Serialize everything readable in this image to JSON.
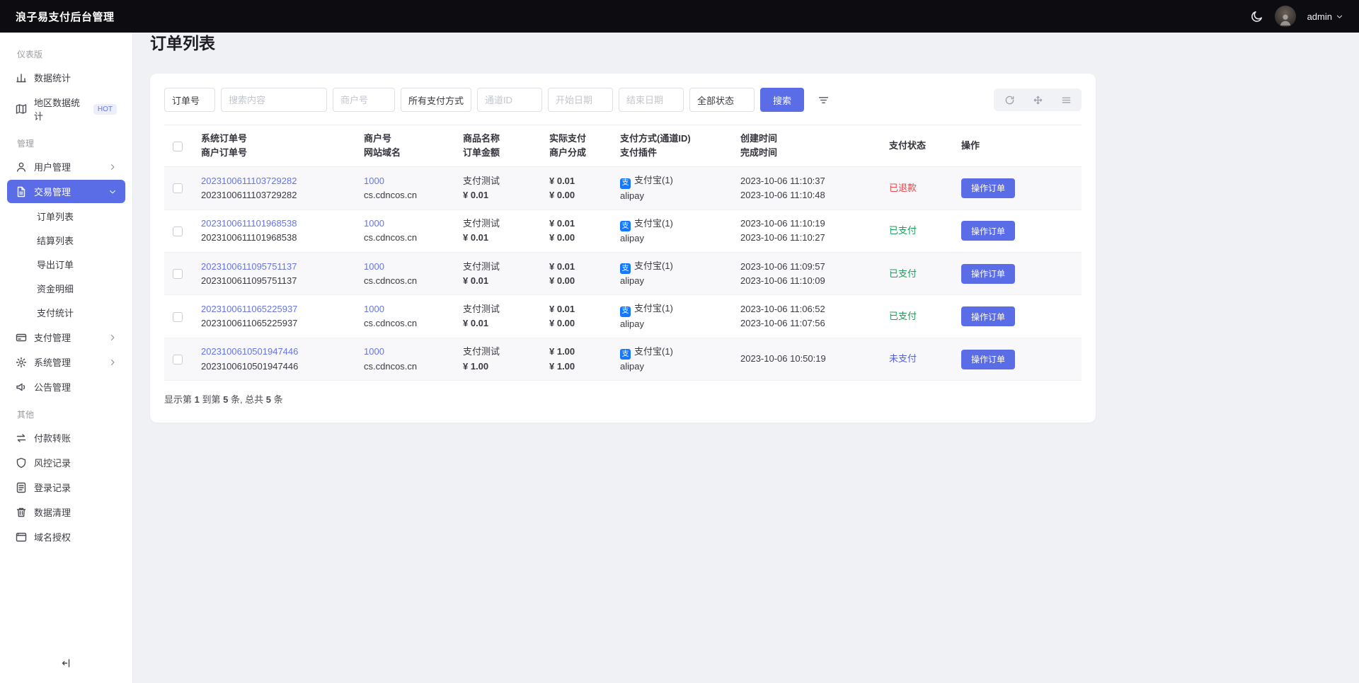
{
  "topbar": {
    "title": "浪子易支付后台管理",
    "username": "admin",
    "theme_icon": "moon-icon",
    "user_caret_icon": "chevron-down-icon"
  },
  "sidebar": {
    "sections": [
      {
        "label": "仪表版",
        "items": [
          {
            "label": "数据统计",
            "icon": "bar-chart-icon"
          },
          {
            "label": "地区数据统计",
            "icon": "map-icon",
            "badge": "HOT"
          }
        ]
      },
      {
        "label": "管理",
        "items": [
          {
            "label": "用户管理",
            "icon": "user-icon",
            "chevron": "right"
          },
          {
            "label": "交易管理",
            "icon": "document-icon",
            "chevron": "down",
            "active": true,
            "children": [
              {
                "label": "订单列表",
                "active": true
              },
              {
                "label": "结算列表"
              },
              {
                "label": "导出订单"
              },
              {
                "label": "资金明细"
              },
              {
                "label": "支付统计"
              }
            ]
          },
          {
            "label": "支付管理",
            "icon": "card-icon",
            "chevron": "right"
          },
          {
            "label": "系统管理",
            "icon": "gear-icon",
            "chevron": "right"
          },
          {
            "label": "公告管理",
            "icon": "megaphone-icon"
          }
        ]
      },
      {
        "label": "其他",
        "items": [
          {
            "label": "付款转账",
            "icon": "transfer-icon"
          },
          {
            "label": "风控记录",
            "icon": "shield-icon"
          },
          {
            "label": "登录记录",
            "icon": "log-icon"
          },
          {
            "label": "数据清理",
            "icon": "trash-icon"
          },
          {
            "label": "域名授权",
            "icon": "domain-icon"
          }
        ]
      }
    ],
    "collapse_icon": "collapse-left-icon"
  },
  "page": {
    "title": "订单列表"
  },
  "filters": {
    "order_no_select": "订单号",
    "search_placeholder": "搜索内容",
    "merchant_placeholder": "商户号",
    "pay_method_select": "所有支付方式",
    "channel_placeholder": "通道ID",
    "start_date_placeholder": "开始日期",
    "end_date_placeholder": "结束日期",
    "status_select": "全部状态",
    "search_button": "搜索",
    "filter_icon": "sort-lines-icon",
    "toolbar_icons": [
      "refresh-icon",
      "fullscreen-icon",
      "columns-icon"
    ]
  },
  "table": {
    "headers": [
      {
        "line1": "系统订单号",
        "line2": "商户订单号"
      },
      {
        "line1": "商户号",
        "line2": "网站域名"
      },
      {
        "line1": "商品名称",
        "line2": "订单金额"
      },
      {
        "line1": "实际支付",
        "line2": "商户分成"
      },
      {
        "line1": "支付方式(通道ID)",
        "line2": "支付插件"
      },
      {
        "line1": "创建时间",
        "line2": "完成时间"
      },
      {
        "line1": "支付状态",
        "line2": ""
      },
      {
        "line1": "操作",
        "line2": ""
      }
    ],
    "action_label": "操作订单",
    "pay_icon_glyph": "支",
    "rows": [
      {
        "sys_order": "2023100611103729282",
        "merchant_order": "2023100611103729282",
        "merchant_id": "1000",
        "domain": "cs.cdncos.cn",
        "product": "支付测试",
        "order_amount": "¥ 0.01",
        "paid": "¥ 0.01",
        "share": "¥ 0.00",
        "method": "支付宝(1)",
        "plugin": "alipay",
        "created": "2023-10-06 11:10:37",
        "completed": "2023-10-06 11:10:48",
        "status": "已退款",
        "status_type": "refunded"
      },
      {
        "sys_order": "2023100611101968538",
        "merchant_order": "2023100611101968538",
        "merchant_id": "1000",
        "domain": "cs.cdncos.cn",
        "product": "支付测试",
        "order_amount": "¥ 0.01",
        "paid": "¥ 0.01",
        "share": "¥ 0.00",
        "method": "支付宝(1)",
        "plugin": "alipay",
        "created": "2023-10-06 11:10:19",
        "completed": "2023-10-06 11:10:27",
        "status": "已支付",
        "status_type": "paid"
      },
      {
        "sys_order": "2023100611095751137",
        "merchant_order": "2023100611095751137",
        "merchant_id": "1000",
        "domain": "cs.cdncos.cn",
        "product": "支付测试",
        "order_amount": "¥ 0.01",
        "paid": "¥ 0.01",
        "share": "¥ 0.00",
        "method": "支付宝(1)",
        "plugin": "alipay",
        "created": "2023-10-06 11:09:57",
        "completed": "2023-10-06 11:10:09",
        "status": "已支付",
        "status_type": "paid"
      },
      {
        "sys_order": "2023100611065225937",
        "merchant_order": "2023100611065225937",
        "merchant_id": "1000",
        "domain": "cs.cdncos.cn",
        "product": "支付测试",
        "order_amount": "¥ 0.01",
        "paid": "¥ 0.01",
        "share": "¥ 0.00",
        "method": "支付宝(1)",
        "plugin": "alipay",
        "created": "2023-10-06 11:06:52",
        "completed": "2023-10-06 11:07:56",
        "status": "已支付",
        "status_type": "paid"
      },
      {
        "sys_order": "2023100610501947446",
        "merchant_order": "2023100610501947446",
        "merchant_id": "1000",
        "domain": "cs.cdncos.cn",
        "product": "支付测试",
        "order_amount": "¥ 1.00",
        "paid": "¥ 1.00",
        "share": "¥ 1.00",
        "method": "支付宝(1)",
        "plugin": "alipay",
        "created": "2023-10-06 10:50:19",
        "completed": "",
        "status": "未支付",
        "status_type": "unpaid"
      }
    ]
  },
  "pagination": {
    "parts": [
      {
        "text": "显示第 "
      },
      {
        "text": "1",
        "bold": true
      },
      {
        "text": " 到第 "
      },
      {
        "text": "5",
        "bold": true
      },
      {
        "text": " 条, 总共 "
      },
      {
        "text": "5",
        "bold": true
      },
      {
        "text": " 条"
      }
    ]
  },
  "colors": {
    "accent": "#5a6ce6",
    "link": "#6474ec",
    "status_refunded": "#e5484d",
    "status_paid": "#18a058",
    "status_unpaid": "#5560dd",
    "alipay_blue": "#1677ff",
    "topbar_bg": "#0d0d11"
  }
}
